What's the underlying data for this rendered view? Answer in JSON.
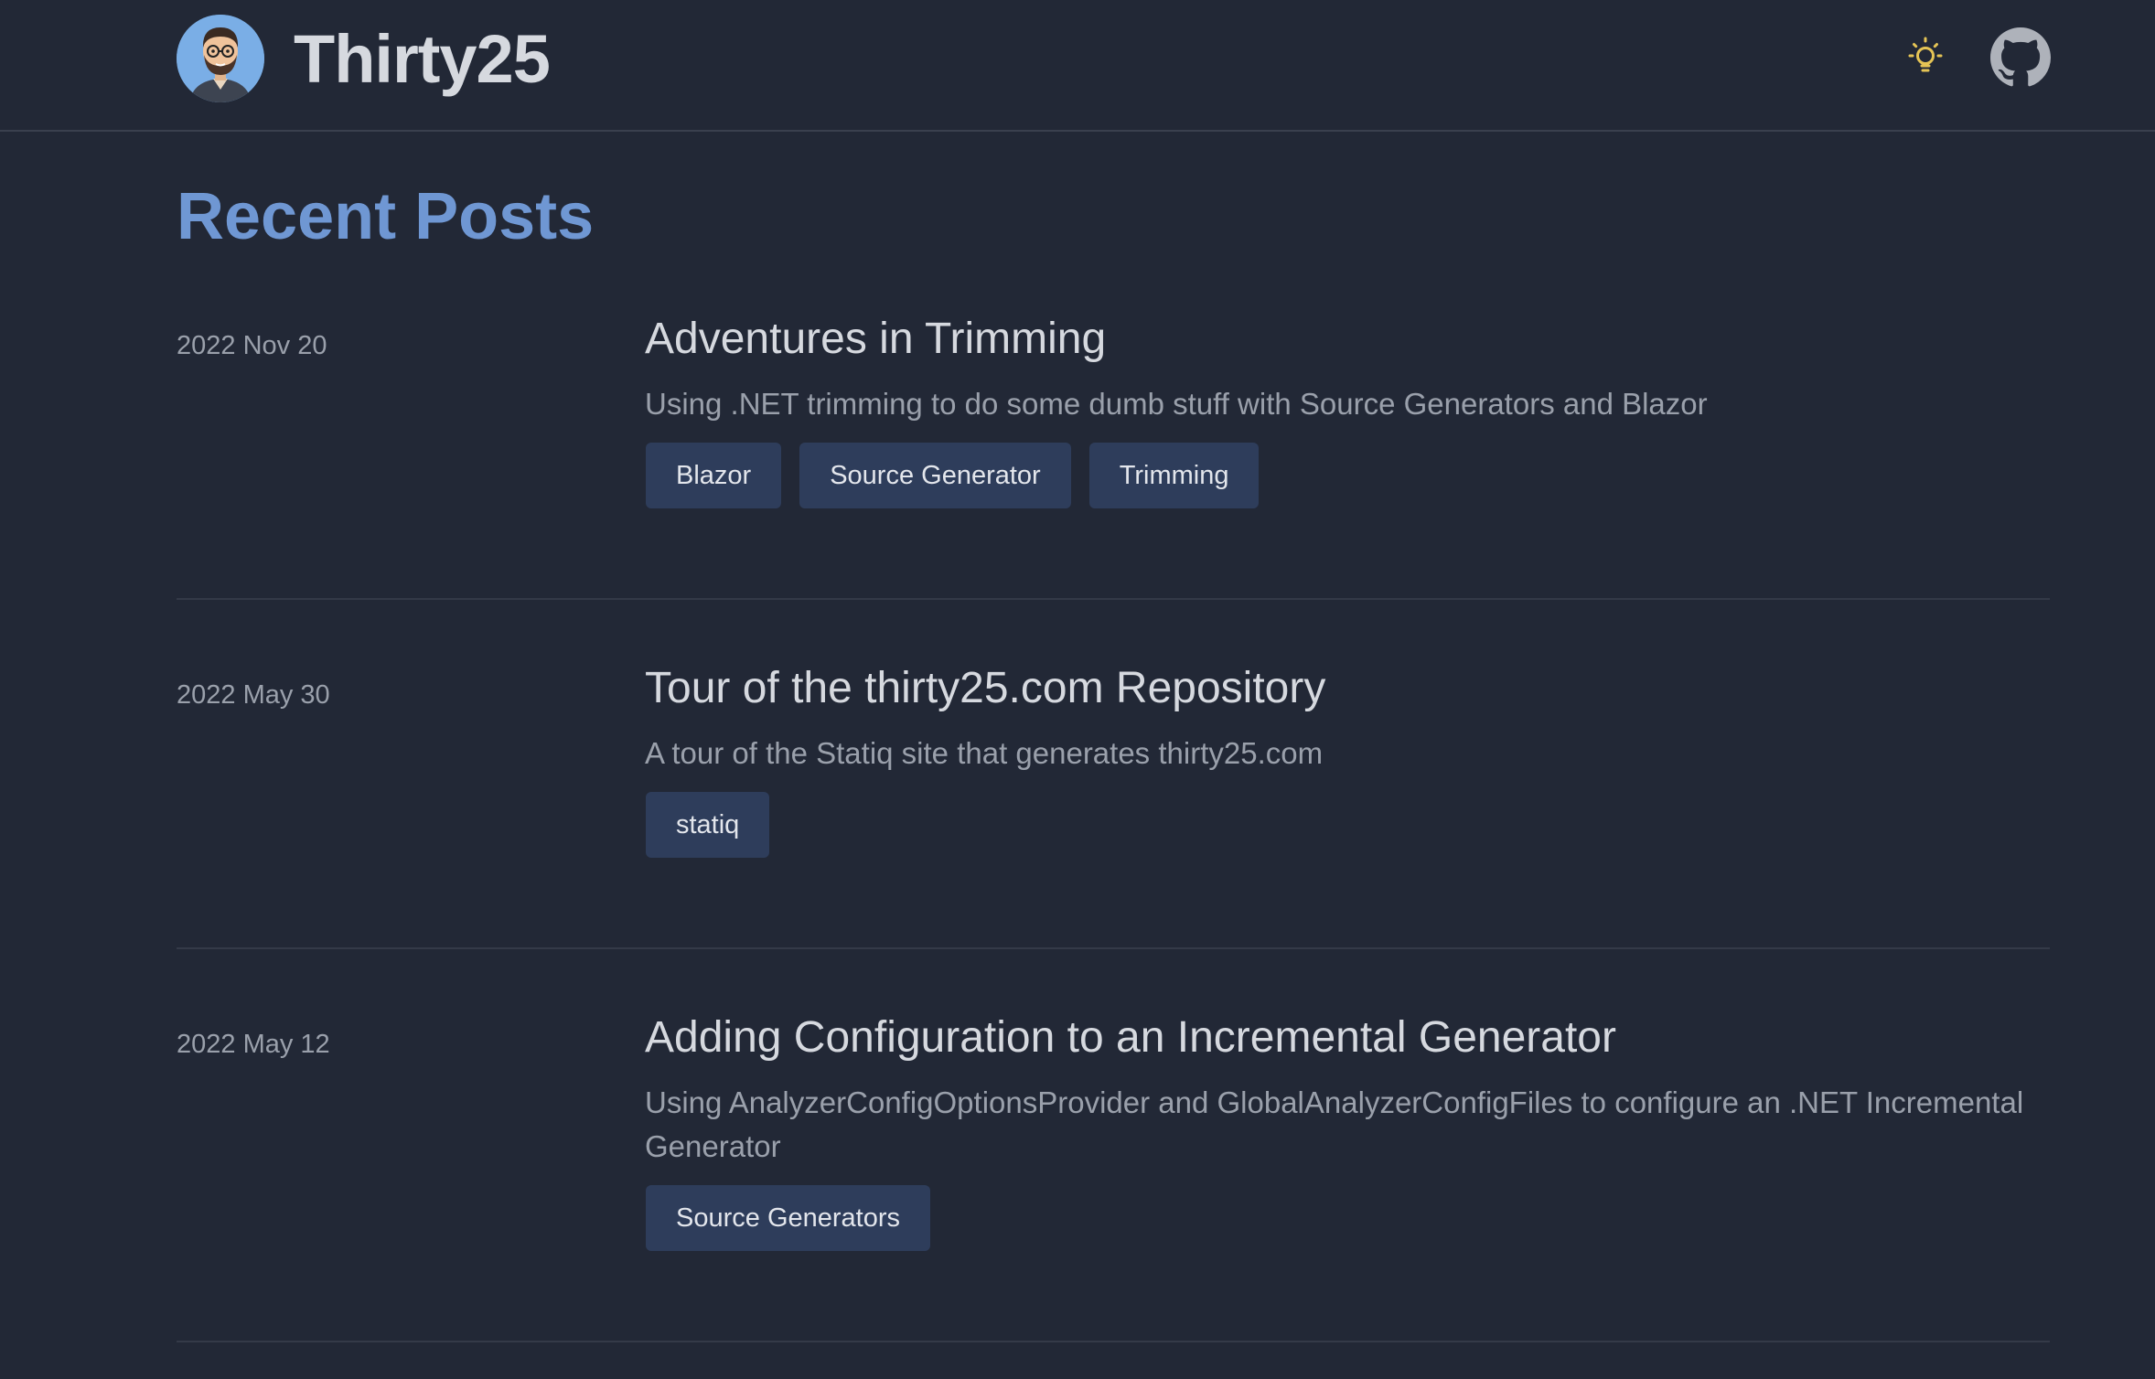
{
  "header": {
    "site_title": "Thirty25",
    "avatar_icon": "avatar-icon",
    "theme_toggle_icon": "lightbulb-icon",
    "github_icon": "github-icon",
    "accent_color": "#6f97d3",
    "lightbulb_color": "#e5c455"
  },
  "main": {
    "title": "Recent Posts",
    "posts": [
      {
        "date": "2022 Nov 20",
        "title": "Adventures in Trimming",
        "description": "Using .NET trimming to do some dumb stuff with Source Generators and Blazor",
        "tags": [
          "Blazor",
          "Source Generator",
          "Trimming"
        ]
      },
      {
        "date": "2022 May 30",
        "title": "Tour of the thirty25.com Repository",
        "description": "A tour of the Statiq site that generates thirty25.com",
        "tags": [
          "statiq"
        ]
      },
      {
        "date": "2022 May 12",
        "title": "Adding Configuration to an Incremental Generator",
        "description": "Using AnalyzerConfigOptionsProvider and GlobalAnalyzerConfigFiles to configure an .NET Incremental Generator",
        "tags": [
          "Source Generators"
        ]
      }
    ]
  }
}
